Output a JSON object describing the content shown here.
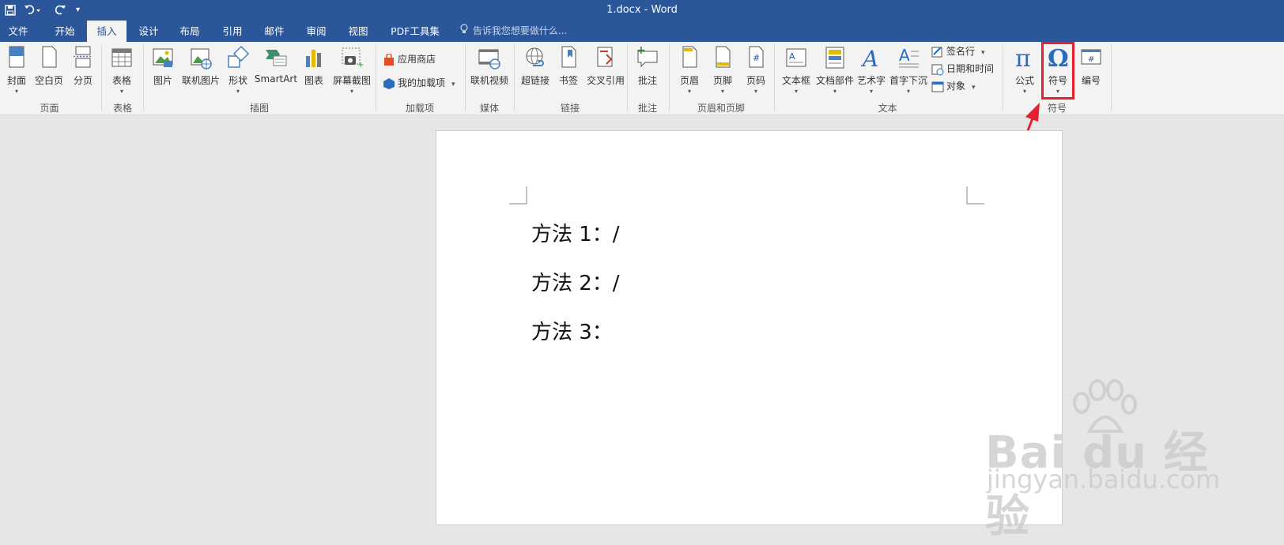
{
  "titlebar": {
    "doc_title": "1.docx - Word",
    "colors": {
      "accent": "#2b579a",
      "highlight": "#e5202e"
    }
  },
  "tabs": [
    "文件",
    "开始",
    "插入",
    "设计",
    "布局",
    "引用",
    "邮件",
    "审阅",
    "视图",
    "PDF工具集"
  ],
  "active_tab": "插入",
  "tellme": "告诉我您想要做什么...",
  "ribbon": {
    "pages": {
      "cover": "封面",
      "blank": "空白页",
      "break": "分页",
      "group": "页面"
    },
    "tables": {
      "table": "表格",
      "group": "表格"
    },
    "illustrations": {
      "picture": "图片",
      "online_picture": "联机图片",
      "shapes": "形状",
      "smartart": "SmartArt",
      "chart": "图表",
      "screenshot": "屏幕截图",
      "group": "插图"
    },
    "addins": {
      "store": "应用商店",
      "my_addins": "我的加载项",
      "group": "加载项"
    },
    "media": {
      "online_video": "联机视频",
      "group": "媒体"
    },
    "links": {
      "hyperlink": "超链接",
      "bookmark": "书签",
      "cross_ref": "交叉引用",
      "group": "链接"
    },
    "comments": {
      "comment": "批注",
      "group": "批注"
    },
    "header_footer": {
      "header": "页眉",
      "footer": "页脚",
      "page_number": "页码",
      "group": "页眉和页脚"
    },
    "text": {
      "textbox": "文本框",
      "quick_parts": "文档部件",
      "wordart": "艺术字",
      "dropcap": "首字下沉",
      "signature": "签名行",
      "datetime": "日期和时间",
      "object": "对象",
      "group": "文本"
    },
    "symbols": {
      "equation": "公式",
      "symbol": "符号",
      "numbering": "编号",
      "group": "符号"
    }
  },
  "document": {
    "paragraphs": [
      "方法 1：/",
      "方法 2：/",
      "方法 3："
    ]
  },
  "watermark": {
    "brand": "Bai du 经验",
    "url": "jingyan.baidu.com"
  }
}
